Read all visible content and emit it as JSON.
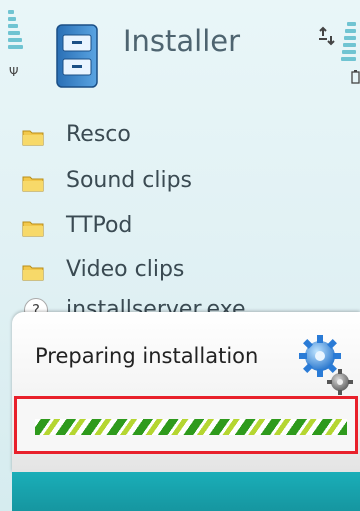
{
  "header": {
    "title": "Installer"
  },
  "list": {
    "items": [
      {
        "type": "folder",
        "label": "Resco"
      },
      {
        "type": "folder",
        "label": "Sound clips"
      },
      {
        "type": "folder",
        "label": "TTPod"
      },
      {
        "type": "folder",
        "label": "Video clips"
      },
      {
        "type": "unknown-file",
        "label": "installserver.exe",
        "badge": "?"
      }
    ]
  },
  "dialog": {
    "message": "Preparing installation",
    "progress": {
      "state": "indeterminate"
    }
  },
  "colors": {
    "accent": "#70c4d2",
    "progress_dark": "#2e9a1c",
    "progress_light": "#b5d631",
    "highlight_border": "#e8202b"
  },
  "icons": {
    "app": "installer-app-icon",
    "folder": "folder-icon",
    "status": [
      "signal-strength-icon",
      "antenna-icon",
      "sync-icon",
      "battery-icon"
    ],
    "dialog": "gears-icon"
  }
}
